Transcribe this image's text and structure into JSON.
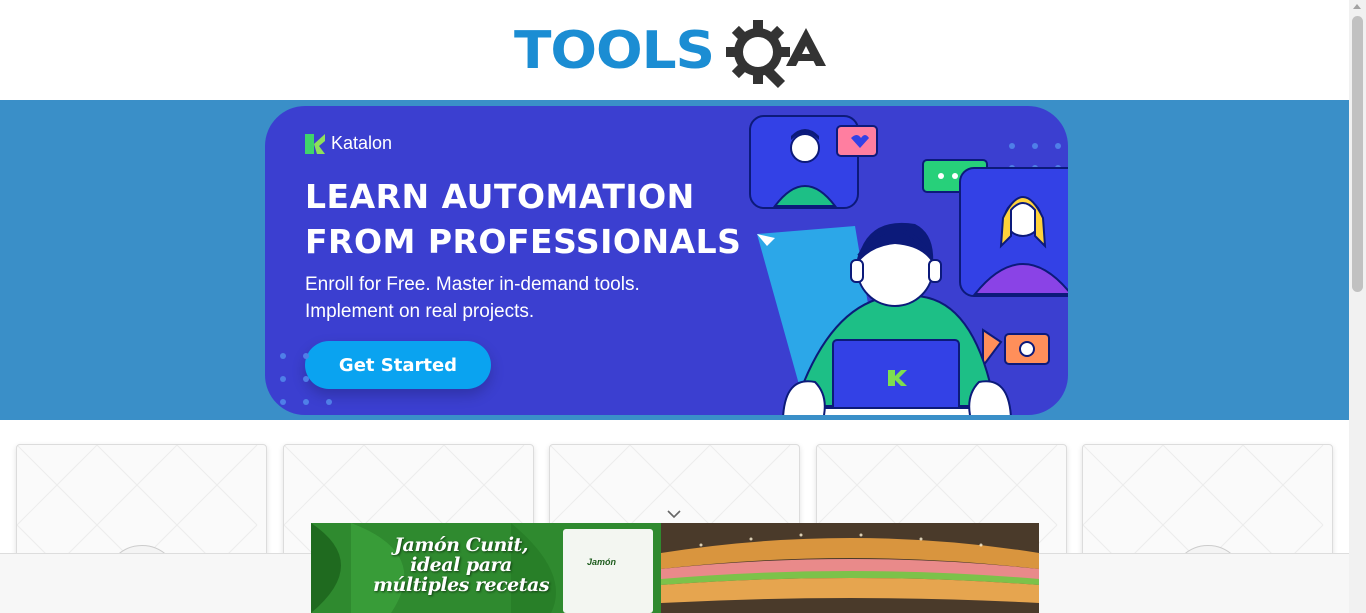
{
  "header": {
    "logo_text": "TOOLSQA"
  },
  "banner": {
    "brand": "Katalon",
    "headline_line1": "LEARN AUTOMATION",
    "headline_line2": "FROM PROFESSIONALS",
    "sub_line1": "Enroll for Free. Master in-demand tools.",
    "sub_line2": "Implement on real projects.",
    "cta_label": "Get Started"
  },
  "ad": {
    "line1": "Jamón Cunit,",
    "line2": "ideal para",
    "line3": "múltiples recetas",
    "pack_label": "Jamón"
  },
  "icons": [
    "chevron-down-icon",
    "katalon-logo-icon",
    "gear-magnifier-icon"
  ],
  "colors": {
    "band": "#3a8fc8",
    "banner": "#3b3fd0",
    "cta": "#0aa3f0",
    "logo_blue": "#1b8dd3",
    "logo_dark": "#333333"
  }
}
